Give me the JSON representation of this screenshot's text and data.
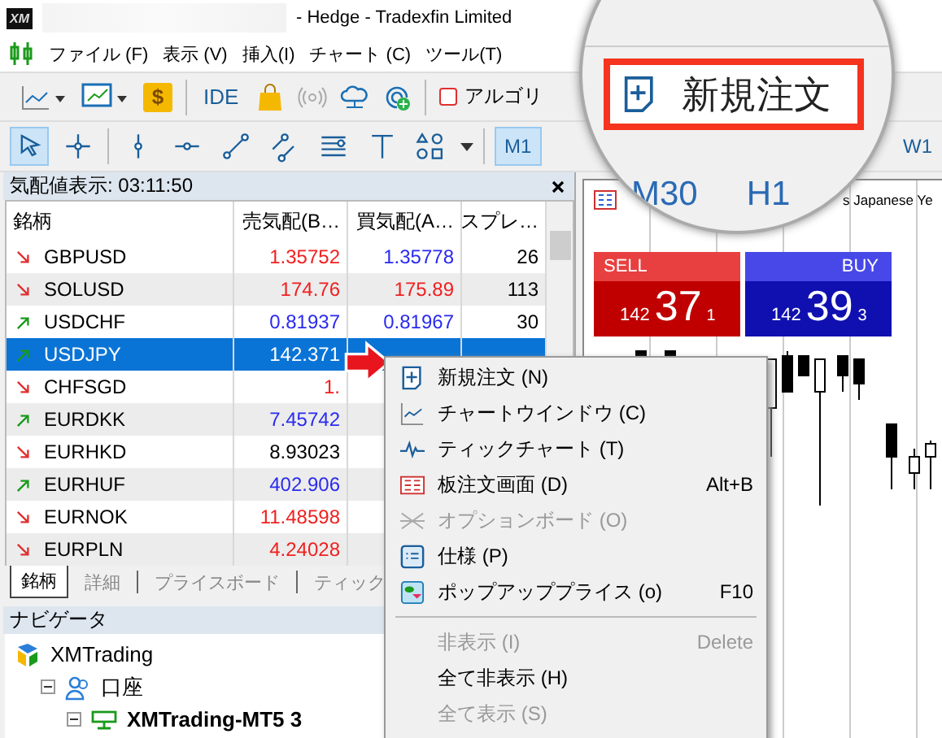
{
  "window": {
    "logo": "XM",
    "title": "- Hedge - Tradexfin Limited"
  },
  "menu": [
    "ファイル (F)",
    "表示 (V)",
    "挿入(I)",
    "チャート (C)",
    "ツール(T)"
  ],
  "toolbar": {
    "dollar": "$",
    "ide": "IDE",
    "algo": "アルゴリ"
  },
  "drawing_tools": [
    {
      "selected": true
    },
    {
      "selected": false
    },
    {
      "selected": false
    },
    {
      "selected": false
    },
    {
      "selected": false
    },
    {
      "selected": false
    },
    {
      "selected": false
    },
    {
      "selected": false
    },
    {
      "selected": false
    }
  ],
  "timeframes": [
    {
      "label": "M1",
      "selected": true
    },
    {
      "label": "W1",
      "selected": false
    }
  ],
  "magnifier": {
    "button": "新規注文",
    "timeframes": [
      "M30",
      "H1"
    ]
  },
  "market_watch": {
    "title": "気配値表示: 03:11:50",
    "columns": [
      "銘柄",
      "売気配(B…",
      "買気配(A…",
      "スプレ…"
    ],
    "rows": [
      {
        "symbol": "GBPUSD",
        "rising": false,
        "bid": "1.35752",
        "bid_up": false,
        "ask": "1.35778",
        "ask_up": true,
        "spread": "26",
        "selected": false
      },
      {
        "symbol": "SOLUSD",
        "rising": false,
        "bid": "174.76",
        "bid_up": false,
        "ask": "175.89",
        "ask_up": false,
        "spread": "113",
        "selected": false
      },
      {
        "symbol": "USDCHF",
        "rising": true,
        "bid": "0.81937",
        "bid_up": true,
        "ask": "0.81967",
        "ask_up": true,
        "spread": "30",
        "selected": false
      },
      {
        "symbol": "USDJPY",
        "rising": true,
        "bid": "142.371",
        "bid_up": true,
        "selected": true
      },
      {
        "symbol": "CHFSGD",
        "rising": false,
        "bid": "1.",
        "bid_up": false,
        "selected": false
      },
      {
        "symbol": "EURDKK",
        "rising": true,
        "bid": "7.45742",
        "bid_up": true,
        "selected": false
      },
      {
        "symbol": "EURHKD",
        "rising": false,
        "bid": "8.93023",
        "selected": false
      },
      {
        "symbol": "EURHUF",
        "rising": true,
        "bid": "402.906",
        "bid_up": true,
        "selected": false
      },
      {
        "symbol": "EURNOK",
        "rising": false,
        "bid": "11.48598",
        "bid_up": false,
        "selected": false
      },
      {
        "symbol": "EURPLN",
        "rising": false,
        "bid": "4.24028",
        "bid_up": false,
        "selected": false
      }
    ],
    "tabs": [
      {
        "label": "銘柄",
        "selected": true
      },
      {
        "label": "詳細",
        "selected": false
      },
      {
        "label": "プライスボード",
        "selected": false
      },
      {
        "label": "ティック",
        "selected": false
      }
    ]
  },
  "navigator": {
    "title": "ナビゲータ",
    "tree": [
      {
        "label": "XMTrading",
        "children": [
          {
            "label": "口座",
            "expanded": true,
            "children": [
              {
                "label": "XMTrading-MT5 3",
                "expanded": true
              }
            ]
          }
        ]
      }
    ]
  },
  "chart": {
    "title": "s Japanese Ye",
    "sell": {
      "label": "SELL",
      "prefix": "142",
      "big": "37",
      "sup": "1"
    },
    "buy": {
      "label": "BUY",
      "prefix": "142",
      "big": "39",
      "sup": "3"
    }
  },
  "context_menu": {
    "items": [
      {
        "kind": "item",
        "label": "新規注文 (N)",
        "disabled": false
      },
      {
        "kind": "item",
        "label": "チャートウインドウ (C)",
        "disabled": false
      },
      {
        "kind": "item",
        "label": "ティックチャート (T)",
        "disabled": false
      },
      {
        "kind": "item",
        "label": "板注文画面 (D)",
        "shortcut": "Alt+B",
        "disabled": false
      },
      {
        "kind": "item",
        "label": "オプションボード (O)",
        "disabled": true
      },
      {
        "kind": "item",
        "label": "仕様 (P)",
        "disabled": false
      },
      {
        "kind": "item",
        "label": "ポップアッププライス (o)",
        "shortcut": "F10",
        "disabled": false
      },
      {
        "kind": "separator"
      },
      {
        "kind": "item",
        "label": "非表示 (I)",
        "shortcut": "Delete",
        "disabled": true
      },
      {
        "kind": "item",
        "label": "全て非表示 (H)",
        "disabled": false
      },
      {
        "kind": "item",
        "label": "全て表示 (S)",
        "disabled": true
      }
    ]
  }
}
